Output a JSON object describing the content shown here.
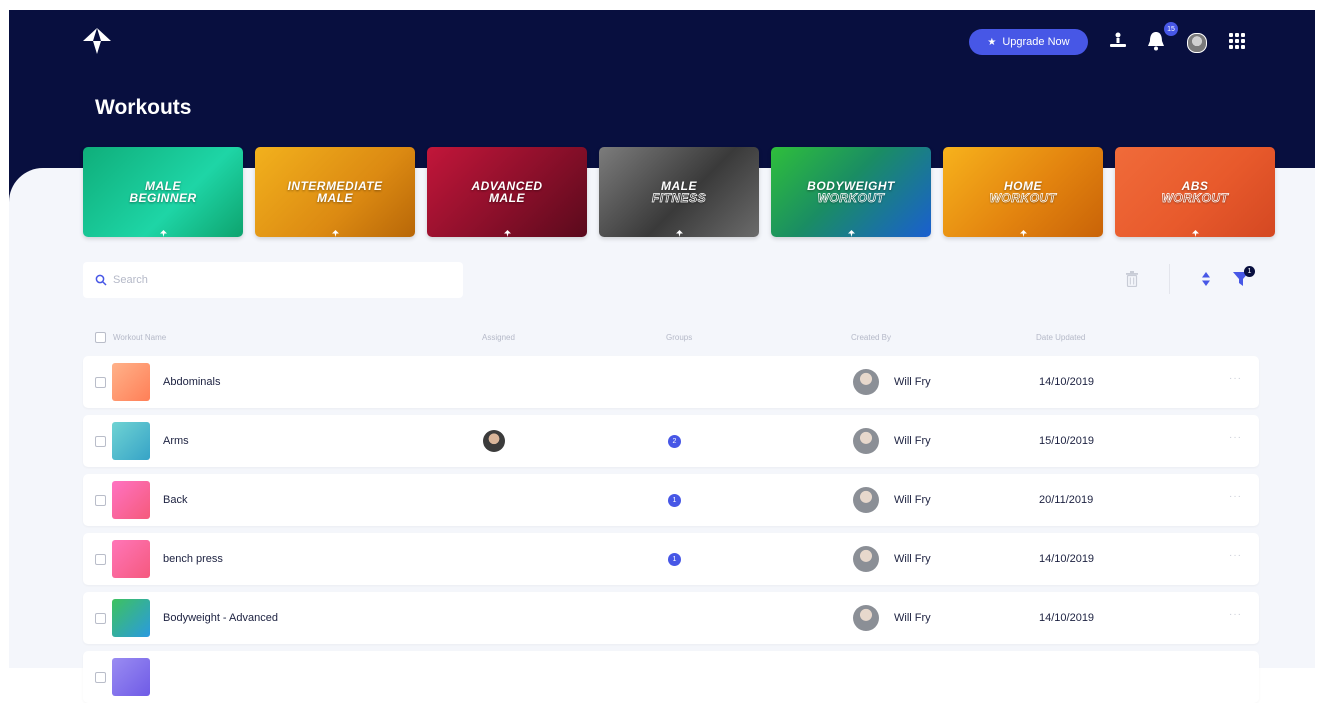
{
  "header": {
    "upgrade_label": "Upgrade Now",
    "notification_count": "15",
    "title": "Workouts"
  },
  "banners": [
    {
      "line1": "MALE",
      "line2": "BEGINNER",
      "outline": false,
      "gradient": "linear-gradient(135deg,#0fae7a,#1ed5a6 60%,#0ea36e)"
    },
    {
      "line1": "INTERMEDIATE",
      "line2": "MALE",
      "outline": false,
      "gradient": "linear-gradient(135deg,#f2b11d,#dc8a12 60%,#b86708)"
    },
    {
      "line1": "ADVANCED",
      "line2": "MALE",
      "outline": false,
      "gradient": "linear-gradient(135deg,#c2163a,#8a0f2a 55%,#5a0a1c)"
    },
    {
      "line1": "MALE",
      "line2": "FITNESS",
      "outline": true,
      "gradient": "linear-gradient(135deg,#7c7c7c,#3a3a3a 55%,#6b6b6b)"
    },
    {
      "line1": "BODYWEIGHT",
      "line2": "WORKOUT",
      "outline": true,
      "gradient": "linear-gradient(135deg,#2fbf3b,#1a8d63 45%,#1a5fd0)"
    },
    {
      "line1": "HOME",
      "line2": "WORKOUT",
      "outline": true,
      "gradient": "linear-gradient(135deg,#f7b21c,#e3840f 55%,#c96308)"
    },
    {
      "line1": "ABS",
      "line2": "WORKOUT",
      "outline": true,
      "gradient": "linear-gradient(135deg,#f06b3a,#e85a2c 55%,#d44822)"
    }
  ],
  "search": {
    "placeholder": "Search"
  },
  "filter_count": "1",
  "table": {
    "headers": {
      "name": "Workout Name",
      "assigned": "Assigned",
      "groups": "Groups",
      "created_by": "Created By",
      "date_updated": "Date Updated"
    },
    "rows": [
      {
        "name": "Abdominals",
        "assigned": false,
        "groups": "",
        "creator": "Will Fry",
        "date": "14/10/2019",
        "thumb": "linear-gradient(135deg,#ffb28a,#ff7f57)"
      },
      {
        "name": "Arms",
        "assigned": true,
        "groups": "2",
        "creator": "Will Fry",
        "date": "15/10/2019",
        "thumb": "linear-gradient(135deg,#6fd3d3,#36a3c7)"
      },
      {
        "name": "Back",
        "assigned": false,
        "groups": "1",
        "creator": "Will Fry",
        "date": "20/11/2019",
        "thumb": "linear-gradient(135deg,#ff73c2,#f55a7b)"
      },
      {
        "name": "bench press",
        "assigned": false,
        "groups": "1",
        "creator": "Will Fry",
        "date": "14/10/2019",
        "thumb": "linear-gradient(135deg,#ff76b8,#f5597e)"
      },
      {
        "name": "Bodyweight - Advanced",
        "assigned": false,
        "groups": "",
        "creator": "Will Fry",
        "date": "14/10/2019",
        "thumb": "linear-gradient(135deg,#3ec25e,#2a9ae0)"
      },
      {
        "name": "",
        "assigned": false,
        "groups": "",
        "creator": "",
        "date": "",
        "thumb": "linear-gradient(135deg,#9a8cf2,#6f5be6)"
      }
    ]
  }
}
